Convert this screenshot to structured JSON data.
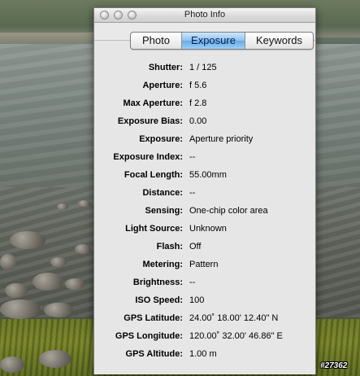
{
  "window": {
    "title": "Photo Info"
  },
  "tabs": [
    {
      "label": "Photo",
      "selected": false
    },
    {
      "label": "Exposure",
      "selected": true
    },
    {
      "label": "Keywords",
      "selected": false
    }
  ],
  "exposure": {
    "rows": [
      {
        "label": "Shutter:",
        "value": "1 / 125"
      },
      {
        "label": "Aperture:",
        "value": "f 5.6"
      },
      {
        "label": "Max Aperture:",
        "value": "f 2.8"
      },
      {
        "label": "Exposure Bias:",
        "value": "0.00"
      },
      {
        "label": "Exposure:",
        "value": "Aperture priority"
      },
      {
        "label": "Exposure Index:",
        "value": "--"
      },
      {
        "label": "Focal Length:",
        "value": "55.00mm"
      },
      {
        "label": "Distance:",
        "value": "--"
      },
      {
        "label": "Sensing:",
        "value": "One-chip color area"
      },
      {
        "label": "Light Source:",
        "value": "Unknown"
      },
      {
        "label": "Flash:",
        "value": "Off"
      },
      {
        "label": "Metering:",
        "value": "Pattern"
      },
      {
        "label": "Brightness:",
        "value": "--"
      },
      {
        "label": "ISO Speed:",
        "value": "100"
      },
      {
        "label": "GPS Latitude:",
        "value": "24.00˚ 18.00' 12.40\" N"
      },
      {
        "label": "GPS Longitude:",
        "value": "120.00˚ 32.00' 46.86\" E"
      },
      {
        "label": "GPS Altitude:",
        "value": "1.00 m"
      }
    ]
  },
  "stamp": {
    "text": "#27362"
  },
  "colors": {
    "selected_tab": "#6aaae8",
    "panel_bg": "#e6e6e6"
  }
}
